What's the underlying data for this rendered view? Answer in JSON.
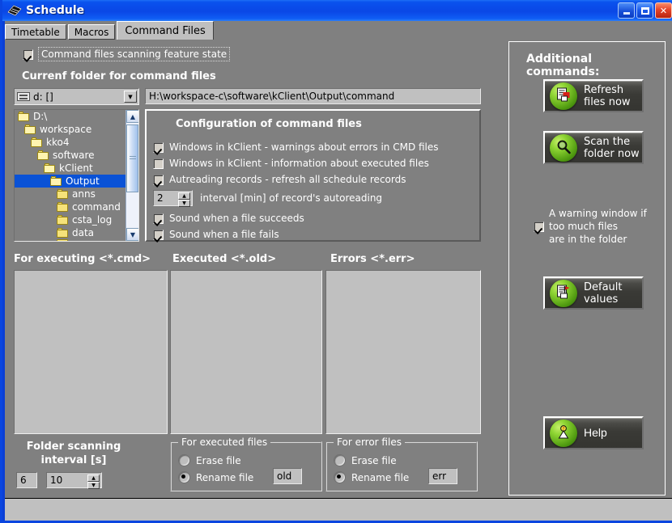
{
  "window": {
    "title": "Schedule",
    "icon": "schedule-icon",
    "controls": {
      "minimize": "minimize-button",
      "maximize": "maximize-button",
      "close": "close-button"
    }
  },
  "tabs": [
    {
      "label": "Timetable",
      "active": false
    },
    {
      "label": "Macros",
      "active": false
    },
    {
      "label": "Command Files",
      "active": true
    }
  ],
  "feature": {
    "checkbox_label": "Command files scanning feature state",
    "checked": true
  },
  "folder_section": {
    "heading": "Currenf folder for command files",
    "drive_combo": {
      "value": "d: []",
      "icon": "drive-icon"
    },
    "path_field": {
      "value": "H:\\workspace-c\\software\\kClient\\Output\\command"
    },
    "tree": [
      {
        "label": "D:\\",
        "depth": 0,
        "selected": false,
        "open": true
      },
      {
        "label": "workspace",
        "depth": 1,
        "selected": false,
        "open": true
      },
      {
        "label": "kko4",
        "depth": 2,
        "selected": false,
        "open": true
      },
      {
        "label": "software",
        "depth": 3,
        "selected": false,
        "open": true
      },
      {
        "label": "kClient",
        "depth": 4,
        "selected": false,
        "open": true
      },
      {
        "label": "Output",
        "depth": 5,
        "selected": true,
        "open": true
      },
      {
        "label": "anns",
        "depth": 6,
        "selected": false,
        "open": false
      },
      {
        "label": "command",
        "depth": 6,
        "selected": false,
        "open": false
      },
      {
        "label": "csta_log",
        "depth": 6,
        "selected": false,
        "open": false
      },
      {
        "label": "data",
        "depth": 6,
        "selected": false,
        "open": false
      }
    ]
  },
  "config": {
    "title": "Configuration of command files",
    "options": [
      {
        "label": "Windows in kClient - warnings about errors in CMD files",
        "checked": true
      },
      {
        "label": "Windows in kClient - information about executed files",
        "checked": false
      },
      {
        "label": "Autreading records - refresh all schedule records",
        "checked": true
      }
    ],
    "interval": {
      "value": "2",
      "label": "interval [min] of record's autoreading"
    },
    "sounds": [
      {
        "label": "Sound when a file succeeds",
        "checked": true
      },
      {
        "label": "Sound when a file fails",
        "checked": true
      }
    ]
  },
  "lists": [
    {
      "header": "For executing <*.cmd>",
      "items": []
    },
    {
      "header": "Executed <*.old>",
      "items": []
    },
    {
      "header": "Errors <*.err>",
      "items": []
    }
  ],
  "scanning": {
    "heading_line1": "Folder scanning",
    "heading_line2": "interval [s]",
    "current_value": "6",
    "set_value": "10"
  },
  "executed_files_group": {
    "title": "For executed files",
    "options": [
      {
        "label": "Erase file",
        "selected": false
      },
      {
        "label": "Rename file",
        "selected": true
      }
    ],
    "extension": "old"
  },
  "error_files_group": {
    "title": "For error files",
    "options": [
      {
        "label": "Erase file",
        "selected": false
      },
      {
        "label": "Rename file",
        "selected": true
      }
    ],
    "extension": "err"
  },
  "additional": {
    "heading": "Additional commands:",
    "refresh_button": "Refresh\nfiles now",
    "scan_button": "Scan the\nfolder now",
    "warning_checkbox": {
      "checked": true,
      "line1": "A warning window if",
      "line2": "too much files",
      "line3": "are in the folder"
    },
    "default_button": "Default\nvalues",
    "help_button": "Help"
  },
  "colors": {
    "titlebar": "#0a47e6",
    "client_bg": "#808080",
    "field_bg": "#c0c0c0",
    "selection": "#0a52d6",
    "orb_green": "#8ed433"
  }
}
